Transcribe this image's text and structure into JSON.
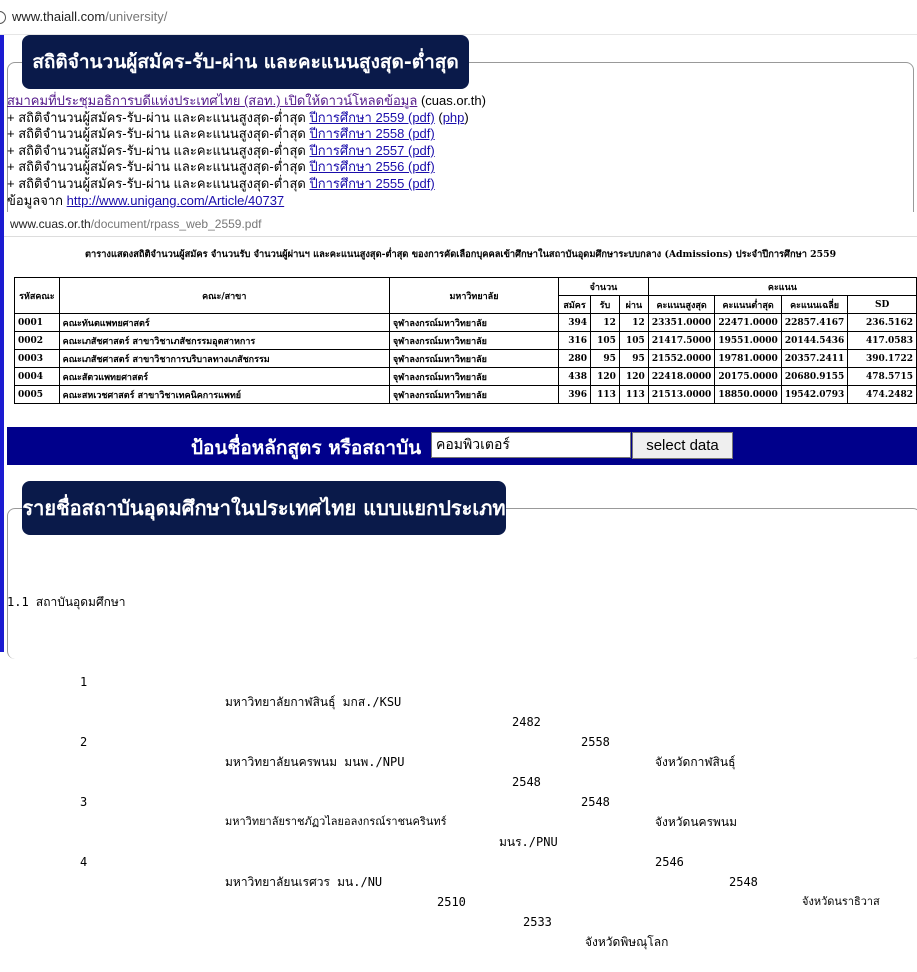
{
  "browser": {
    "url_host": "www.thaiall.com",
    "url_path": "/university/"
  },
  "section1": {
    "title": "สถิติจำนวนผู้สมัคร-รับ-ผ่าน และคะแนนสูงสุด-ต่ำสุด",
    "cuas_link": "สมาคมที่ประชุมอธิการบดีแห่งประเทศไทย (สอท.) เปิดให้ดาวน์โหลดข้อมูล",
    "cuas_suffix": "(cuas.or.th)",
    "items": [
      {
        "prefix": "+ สถิติจำนวนผู้สมัคร-รับ-ผ่าน และคะแนนสูงสุด-ต่ำสุด",
        "link": "ปีการศึกษา 2559 (pdf)",
        "extra_open": "(",
        "extra": "php",
        "extra_close": ")"
      },
      {
        "prefix": "+ สถิติจำนวนผู้สมัคร-รับ-ผ่าน และคะแนนสูงสุด-ต่ำสุด",
        "link": "ปีการศึกษา 2558 (pdf)"
      },
      {
        "prefix": "+ สถิติจำนวนผู้สมัคร-รับ-ผ่าน และคะแนนสูงสุด-ต่ำสุด",
        "link": "ปีการศึกษา 2557 (pdf)"
      },
      {
        "prefix": "+ สถิติจำนวนผู้สมัคร-รับ-ผ่าน และคะแนนสูงสุด-ต่ำสุด",
        "link": "ปีการศึกษา 2556 (pdf)"
      },
      {
        "prefix": "+ สถิติจำนวนผู้สมัคร-รับ-ผ่าน และคะแนนสูงสุด-ต่ำสุด",
        "link": "ปีการศึกษา 2555 (pdf)"
      }
    ],
    "source_prefix": "ข้อมูลจาก",
    "source_link": "http://www.unigang.com/Article/40737"
  },
  "pdf": {
    "url_host": "www.cuas.or.th",
    "url_path": "/document/rpass_web_2559.pdf",
    "title": "ตารางแสดงสถิติจำนวนผู้สมัคร จำนวนรับ จำนวนผู้ผ่านฯ และคะแนนสูงสุด-ต่ำสุด ของการคัดเลือกบุคคลเข้าศึกษาในสถาบันอุดมศึกษาระบบกลาง (Admissions) ประจำปีการศึกษา 2559",
    "headers": {
      "code": "รหัสคณะ",
      "faculty": "คณะ/สาขา",
      "university": "มหาวิทยาลัย",
      "count_group": "จำนวน",
      "score_group": "คะแนน",
      "apply": "สมัคร",
      "accept": "รับ",
      "pass": "ผ่าน",
      "max": "คะแนนสูงสุด",
      "min": "คะแนนต่ำสุด",
      "avg": "คะแนนเฉลี่ย",
      "sd": "SD"
    },
    "rows": [
      {
        "code": "0001",
        "faculty": "คณะทันตแพทยศาสตร์",
        "university": "จุฬาลงกรณ์มหาวิทยาลัย",
        "apply": "394",
        "accept": "12",
        "pass": "12",
        "max": "23351.0000",
        "min": "22471.0000",
        "avg": "22857.4167",
        "sd": "236.5162"
      },
      {
        "code": "0002",
        "faculty": "คณะเภสัชศาสตร์ สาขาวิชาเภสัชกรรมอุตสาหการ",
        "university": "จุฬาลงกรณ์มหาวิทยาลัย",
        "apply": "316",
        "accept": "105",
        "pass": "105",
        "max": "21417.5000",
        "min": "19551.0000",
        "avg": "20144.5436",
        "sd": "417.0583"
      },
      {
        "code": "0003",
        "faculty": "คณะเภสัชศาสตร์ สาขาวิชาการบริบาลทางเภสัชกรรม",
        "university": "จุฬาลงกรณ์มหาวิทยาลัย",
        "apply": "280",
        "accept": "95",
        "pass": "95",
        "max": "21552.0000",
        "min": "19781.0000",
        "avg": "20357.2411",
        "sd": "390.1722"
      },
      {
        "code": "0004",
        "faculty": "คณะสัตวแพทยศาสตร์",
        "university": "จุฬาลงกรณ์มหาวิทยาลัย",
        "apply": "438",
        "accept": "120",
        "pass": "120",
        "max": "22418.0000",
        "min": "20175.0000",
        "avg": "20680.9155",
        "sd": "478.5715"
      },
      {
        "code": "0005",
        "faculty": "คณะสหเวชศาสตร์ สาขาวิชาเทคนิคการแพทย์",
        "university": "จุฬาลงกรณ์มหาวิทยาลัย",
        "apply": "396",
        "accept": "113",
        "pass": "113",
        "max": "21513.0000",
        "min": "18850.0000",
        "avg": "19542.0793",
        "sd": "474.2482"
      }
    ]
  },
  "search": {
    "label": "ป้อนชื่อหลักสูตร หรือสถาบัน",
    "input_value": "คอมพิวเตอร์",
    "button_label": "select data"
  },
  "section2": {
    "title": "รายชื่อสถาบันอุดมศึกษาในประเทศไทย แบบแยกประเภท",
    "group": "1.1 สถาบันอุดมศึกษา",
    "rows": [
      {
        "no": "1",
        "name": "มหาวิทยาลัยกาฬสินธุ์ มกส./KSU",
        "y1": "2482",
        "y2": "2558",
        "prov": "จังหวัดกาฬสินธุ์"
      },
      {
        "no": "2",
        "name": "มหาวิทยาลัยนครพนม มนพ./NPU",
        "y1": "2548",
        "y2": "2548",
        "prov": "จังหวัดนครพนม"
      },
      {
        "no": "3",
        "name": "มหาวิทยาลัยราชภัฏวไลยอลงกรณ์ราชนครินทร์",
        "abbr": "มนร./PNU",
        "y1": "2546",
        "y2": "2548",
        "prov": "จังหวัดนราธิวาส"
      },
      {
        "no": "4",
        "name": "มหาวิทยาลัยนเรศวร มน./NU",
        "y1": "2510",
        "y2": "2533",
        "prov": "จังหวัดพิษณุโลก"
      }
    ]
  }
}
